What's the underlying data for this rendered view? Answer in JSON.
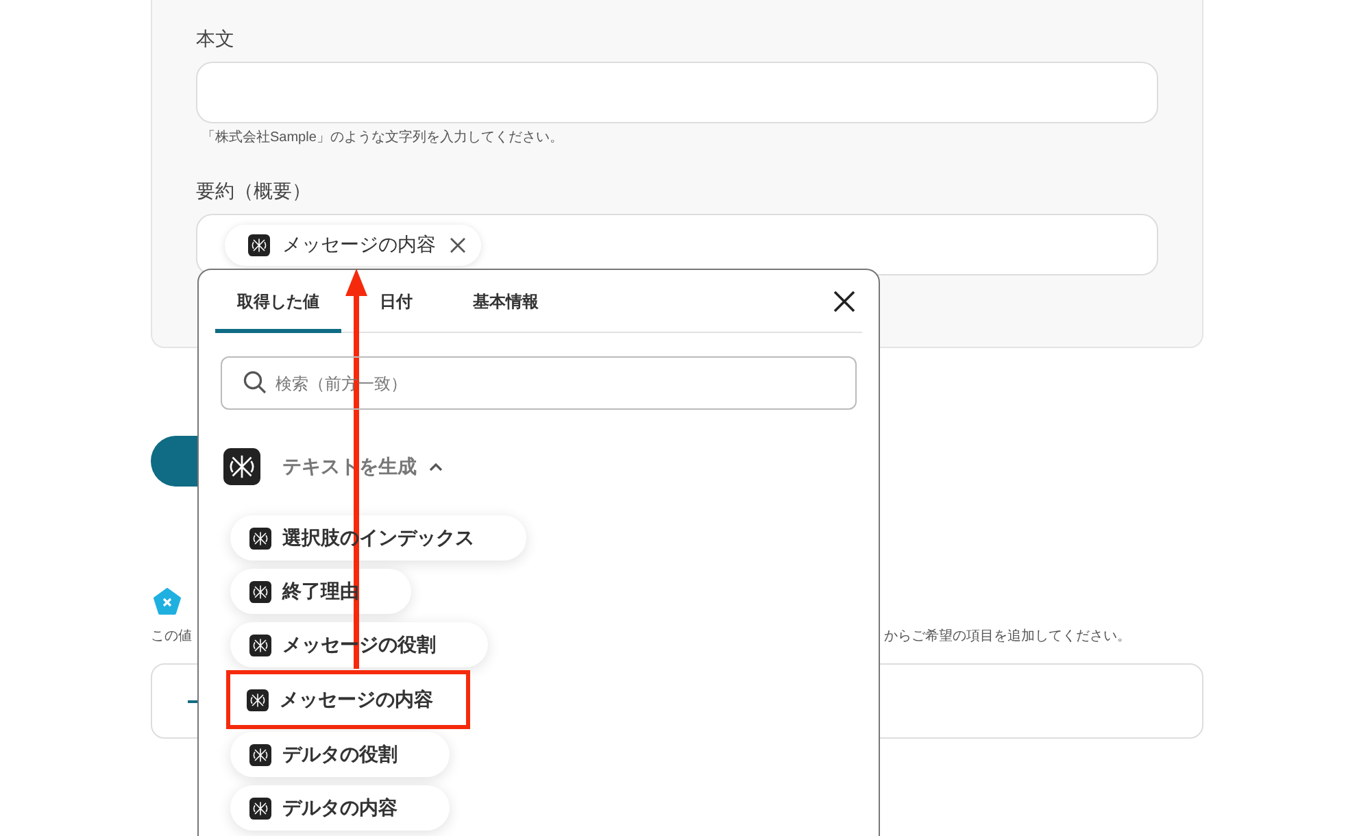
{
  "form": {
    "fields": [
      {
        "label": "本文",
        "hint": "「株式会社Sample」のような文字列を入力してください。"
      },
      {
        "label": "要約（概要）",
        "chips": [
          {
            "text": "メッセージの内容"
          }
        ]
      }
    ]
  },
  "section": {
    "note_left": "この値",
    "note_right": "からご希望の項目を追加してください。"
  },
  "popup": {
    "tabs": [
      {
        "label": "取得した値",
        "selected": true
      },
      {
        "label": "日付",
        "selected": false
      },
      {
        "label": "基本情報",
        "selected": false
      }
    ],
    "search": {
      "placeholder": "検索（前方一致）"
    },
    "group": {
      "title": "テキストを生成",
      "expanded": true
    },
    "items": [
      {
        "label": "選択肢のインデックス",
        "highlighted": false
      },
      {
        "label": "終了理由",
        "highlighted": false
      },
      {
        "label": "メッセージの役割",
        "highlighted": false
      },
      {
        "label": "メッセージの内容",
        "highlighted": true
      },
      {
        "label": "デルタの役割",
        "highlighted": false
      },
      {
        "label": "デルタの内容",
        "highlighted": false
      }
    ]
  }
}
